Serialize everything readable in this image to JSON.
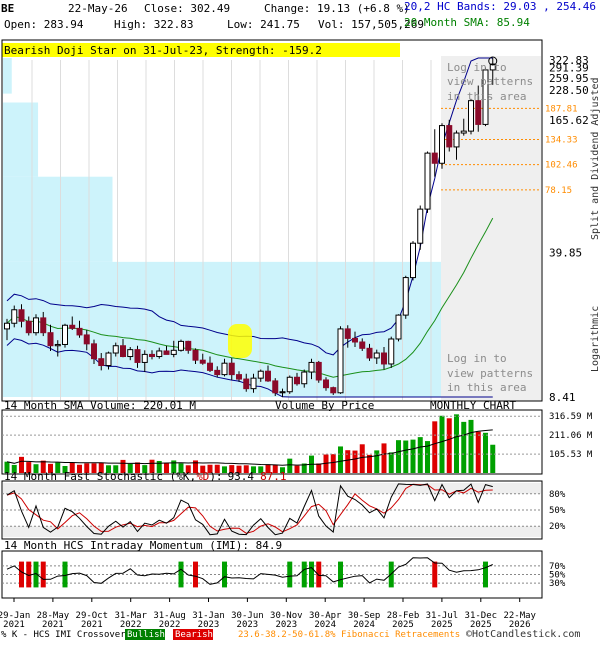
{
  "header": {
    "symbol": "BE",
    "date": "22-May-26",
    "close_text": "Close: 302.49",
    "change_text": "Change: 19.13 (+6.8 %)",
    "bands_text": "20,2 HC Bands: 29.03 , 254.46",
    "open_text": "Open: 283.94",
    "high_text": "High: 322.83",
    "low_text": "Low: 241.75",
    "vol_text": "Vol: 157,505,269",
    "sma_text": "20 Month SMA: 85.94"
  },
  "alert_banner": "Bearish Doji Star on 31-Jul-23, Strength: -159.2",
  "price_axis": {
    "labels": [
      "322.83",
      "291.39",
      "259.95",
      "228.50",
      "165.62",
      "39.85",
      "8.41"
    ],
    "side_label": "Split and Dividend Adjusted",
    "scale_label": "Logarithmic"
  },
  "fib_levels": [
    "187.81",
    "134.33",
    "102.46",
    "78.15"
  ],
  "login_text": [
    "Log in to",
    "view patterns",
    "in this area"
  ],
  "volume_panel": {
    "title": "14 Month SMA Volume: 220.01 M",
    "center_label": "Volume By Price",
    "right_label": "MONTHLY CHART",
    "axis_labels": [
      "316.59 M",
      "211.06 M",
      "105.53 M"
    ]
  },
  "stoch_panel": {
    "title_prefix": "14 Month Fast Stochastic (",
    "k_label": "%K",
    "comma": ",",
    "d_label": "%D",
    "title_suffix": "):",
    "k_value": "93.4",
    "d_value": "87.1",
    "axis_labels": [
      "80%",
      "50%",
      "20%"
    ]
  },
  "imi_panel": {
    "title": "14 Month HCS Intraday Momentum (IMI): 84.9",
    "axis_labels": [
      "70%",
      "50%",
      "30%"
    ]
  },
  "x_axis": {
    "ticks": [
      [
        "29-Jan",
        "2021"
      ],
      [
        "28-May",
        "2021"
      ],
      [
        "29-Oct",
        "2021"
      ],
      [
        "31-Mar",
        "2022"
      ],
      [
        "31-Aug",
        "2022"
      ],
      [
        "31-Jan",
        "2023"
      ],
      [
        "30-Jun",
        "2023"
      ],
      [
        "30-Nov",
        "2023"
      ],
      [
        "30-Apr",
        "2024"
      ],
      [
        "30-Sep",
        "2024"
      ],
      [
        "28-Feb",
        "2025"
      ],
      [
        "31-Jul",
        "2025"
      ],
      [
        "31-Dec",
        "2025"
      ],
      [
        "22-May",
        "2026"
      ]
    ]
  },
  "footer": {
    "prefix": "% K - HCS IMI Crossover,",
    "bullish": "Bullish",
    "bearish": "Bearish",
    "fib": "23.6-38.2-50-61.8% Fibonacci Retracements",
    "credit": "©HotCandlestick.com"
  },
  "colors": {
    "bull": "#008000",
    "bear": "#8b0a2a",
    "band": "#00008b",
    "sma": "#1a8f1a",
    "vbp": "#cdf3fb",
    "alert": "#ffff00",
    "fib": "#ff8c00"
  },
  "chart_data": {
    "type": "candlestick",
    "period": "monthly",
    "scale": "log",
    "ylim": [
      8.41,
      322.83
    ],
    "y_ticks": [
      322.83,
      291.39,
      259.95,
      228.5,
      165.62,
      39.85,
      8.41
    ],
    "last_bar": {
      "open": 283.94,
      "high": 322.83,
      "low": 241.75,
      "close": 302.49,
      "volume": 157505269
    },
    "hc_bands": {
      "period": 20,
      "width": 2,
      "lower": 29.03,
      "upper": 254.46
    },
    "sma_20": 85.94,
    "fibonacci": [
      187.81,
      134.33,
      102.46,
      78.15
    ],
    "x_tick_labels": [
      "29-Jan 2021",
      "28-May 2021",
      "29-Oct 2021",
      "31-Mar 2022",
      "31-Aug 2022",
      "31-Jan 2023",
      "30-Jun 2023",
      "30-Nov 2023",
      "30-Apr 2024",
      "30-Sep 2024",
      "28-Feb 2025",
      "31-Jul 2025",
      "31-Dec 2025",
      "22-May 2026"
    ],
    "candles": [
      [
        17.5,
        19.5,
        15.5,
        18.6
      ],
      [
        18.6,
        22.5,
        17.8,
        21.5
      ],
      [
        21.5,
        22.8,
        17.8,
        19.0
      ],
      [
        19.0,
        20.0,
        16.3,
        16.8
      ],
      [
        16.8,
        20.5,
        16.3,
        19.7
      ],
      [
        19.7,
        21.0,
        16.2,
        16.8
      ],
      [
        16.8,
        18.3,
        13.8,
        14.6
      ],
      [
        14.6,
        15.5,
        13.0,
        14.8
      ],
      [
        14.8,
        18.5,
        14.3,
        18.2
      ],
      [
        18.2,
        20.0,
        17.3,
        17.6
      ],
      [
        17.6,
        19.1,
        15.9,
        16.4
      ],
      [
        16.4,
        17.3,
        13.9,
        14.9
      ],
      [
        14.9,
        15.6,
        12.0,
        12.7
      ],
      [
        12.7,
        13.5,
        11.2,
        11.8
      ],
      [
        11.8,
        13.7,
        11.3,
        13.5
      ],
      [
        13.5,
        15.1,
        13.0,
        14.6
      ],
      [
        14.6,
        15.7,
        12.9,
        13.0
      ],
      [
        13.0,
        14.4,
        12.5,
        14.0
      ],
      [
        14.0,
        14.6,
        11.5,
        12.2
      ],
      [
        12.2,
        13.9,
        11.0,
        13.3
      ],
      [
        13.3,
        13.9,
        12.6,
        13.0
      ],
      [
        13.0,
        14.3,
        12.7,
        13.8
      ],
      [
        13.8,
        14.6,
        13.3,
        13.3
      ],
      [
        13.3,
        15.4,
        12.9,
        13.9
      ],
      [
        13.9,
        15.6,
        13.7,
        15.3
      ],
      [
        15.3,
        15.4,
        13.4,
        13.9
      ],
      [
        13.9,
        14.2,
        12.0,
        12.5
      ],
      [
        12.5,
        13.4,
        11.9,
        12.1
      ],
      [
        12.1,
        13.0,
        11.0,
        11.2
      ],
      [
        11.2,
        11.7,
        10.4,
        10.7
      ],
      [
        10.7,
        12.7,
        10.5,
        12.1
      ],
      [
        12.1,
        12.8,
        10.1,
        10.7
      ],
      [
        10.7,
        11.1,
        9.9,
        10.2
      ],
      [
        10.2,
        10.8,
        8.9,
        9.2
      ],
      [
        9.2,
        10.8,
        8.8,
        10.3
      ],
      [
        10.3,
        11.3,
        9.9,
        11.1
      ],
      [
        11.1,
        11.8,
        9.9,
        10.0
      ],
      [
        10.0,
        10.3,
        8.5,
        8.8
      ],
      [
        8.8,
        9.2,
        8.4,
        8.9
      ],
      [
        8.9,
        10.6,
        8.7,
        10.4
      ],
      [
        10.4,
        10.9,
        9.5,
        9.7
      ],
      [
        9.7,
        11.3,
        9.3,
        11.0
      ],
      [
        11.0,
        12.7,
        10.2,
        12.2
      ],
      [
        12.2,
        12.4,
        9.8,
        10.1
      ],
      [
        10.1,
        10.4,
        9.0,
        9.3
      ],
      [
        9.3,
        9.4,
        8.6,
        8.8
      ],
      [
        8.8,
        18.0,
        8.7,
        17.5
      ],
      [
        17.5,
        18.2,
        14.3,
        15.8
      ],
      [
        15.8,
        17.0,
        14.4,
        15.2
      ],
      [
        15.2,
        15.8,
        13.8,
        14.2
      ],
      [
        14.2,
        14.9,
        12.4,
        12.8
      ],
      [
        12.8,
        14.0,
        12.0,
        13.5
      ],
      [
        13.5,
        14.4,
        11.3,
        12.0
      ],
      [
        12.0,
        16.1,
        11.5,
        15.7
      ],
      [
        15.7,
        20.5,
        15.3,
        20.3
      ],
      [
        20.3,
        31.0,
        19.5,
        30.4
      ],
      [
        30.4,
        45.0,
        29.5,
        44.0
      ],
      [
        44.0,
        66.0,
        41.0,
        63.5
      ],
      [
        63.5,
        118.0,
        61.0,
        116.0
      ],
      [
        116.0,
        150.0,
        90.0,
        104.0
      ],
      [
        104.0,
        160.0,
        98.0,
        156.0
      ],
      [
        156.0,
        166.0,
        118.0,
        124.0
      ],
      [
        124.0,
        148.0,
        108.0,
        144.0
      ],
      [
        144.0,
        168.0,
        140.0,
        147.0
      ],
      [
        147.0,
        208.0,
        142.0,
        204.0
      ],
      [
        204.0,
        240.0,
        146.0,
        158.0
      ],
      [
        158.0,
        292.0,
        155.0,
        283.94
      ],
      [
        283.94,
        322.83,
        241.75,
        302.49
      ]
    ],
    "volume_m": [
      63,
      45,
      90,
      61,
      49,
      69,
      51,
      58,
      39,
      59,
      46,
      54,
      54,
      57,
      43,
      43,
      73,
      51,
      59,
      44,
      74,
      67,
      53,
      70,
      53,
      43,
      70,
      41,
      46,
      46,
      37,
      44,
      41,
      43,
      37,
      37,
      48,
      47,
      32,
      80,
      41,
      53,
      97,
      53,
      103,
      105,
      148,
      127,
      125,
      160,
      101,
      126,
      165,
      115,
      183,
      181,
      186,
      200,
      178,
      288,
      319,
      305,
      327,
      285,
      296,
      230,
      224,
      157.5
    ],
    "volume_by_price": [
      {
        "price_low": 8.41,
        "price_high": 36,
        "volume_share": 1.0
      },
      {
        "price_low": 36,
        "price_high": 55,
        "volume_share": 0.25
      },
      {
        "price_low": 55,
        "price_high": 90,
        "volume_share": 0.25
      },
      {
        "price_low": 90,
        "price_high": 200,
        "volume_share": 0.08
      },
      {
        "price_low": 220,
        "price_high": 322.83,
        "volume_share": 0.02
      }
    ],
    "stochastic_k_last": 93.4,
    "stochastic_d_last": 87.1,
    "imi_last": 84.9
  }
}
